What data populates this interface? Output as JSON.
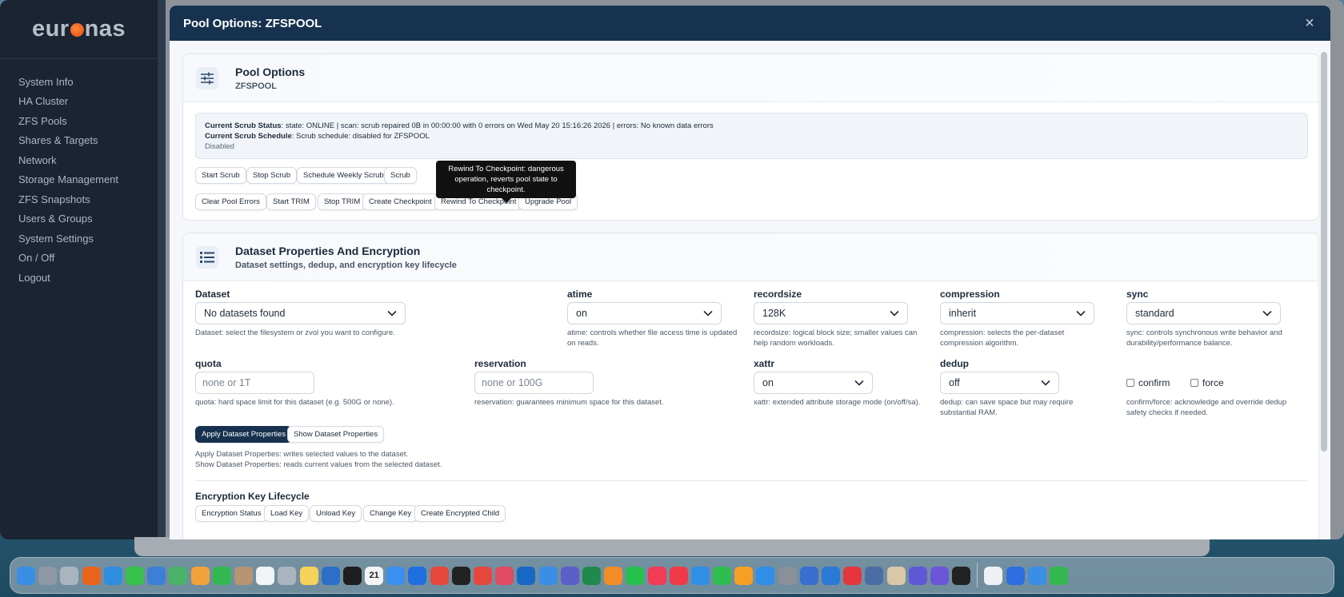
{
  "app": {
    "logo_pre": "eur",
    "logo_post": "nas",
    "nav": [
      {
        "label": "System Info",
        "name": "nav-system-info"
      },
      {
        "label": "HA Cluster",
        "name": "nav-ha-cluster"
      },
      {
        "label": "ZFS Pools",
        "name": "nav-zfs-pools"
      },
      {
        "label": "Shares & Targets",
        "name": "nav-shares-targets"
      },
      {
        "label": "Network",
        "name": "nav-network"
      },
      {
        "label": "Storage Management",
        "name": "nav-storage-management"
      },
      {
        "label": "ZFS Snapshots",
        "name": "nav-zfs-snapshots"
      },
      {
        "label": "Users & Groups",
        "name": "nav-users-groups"
      },
      {
        "label": "System Settings",
        "name": "nav-system-settings"
      },
      {
        "label": "On / Off",
        "name": "nav-on-off"
      },
      {
        "label": "Logout",
        "name": "nav-logout"
      }
    ]
  },
  "modal": {
    "title": "Pool Options: ZFSPOOL",
    "close": "×"
  },
  "pool_options": {
    "title": "Pool Options",
    "subtitle": "ZFSPOOL",
    "status_label": "Current Scrub Status",
    "status_text": ": state: ONLINE | scan: scrub repaired 0B in 00:00:00 with 0 errors on Wed May 20 15:16:26 2026 | errors: No known data errors",
    "schedule_label": "Current Scrub Schedule",
    "schedule_text": ": Scrub schedule: disabled for ZFSPOOL",
    "schedule_state": "Disabled",
    "buttons_row1": [
      "Start Scrub",
      "Stop Scrub",
      "Schedule Weekly Scrub",
      "Scrub"
    ],
    "buttons_row2": [
      "Clear Pool Errors",
      "Start TRIM",
      "Stop TRIM",
      "Create Checkpoint",
      "Rewind To Checkpoint",
      "Upgrade Pool"
    ],
    "tooltip": "Rewind To Checkpoint: dangerous operation, reverts pool state to checkpoint."
  },
  "dataset": {
    "title": "Dataset Properties And Encryption",
    "subtitle": "Dataset settings, dedup, and encryption key lifecycle",
    "fields": {
      "dataset": {
        "label": "Dataset",
        "value": "No datasets found",
        "help": "Dataset: select the filesystem or zvol you want to configure."
      },
      "atime": {
        "label": "atime",
        "value": "on",
        "help": "atime: controls whether file access time is updated on reads."
      },
      "recordsize": {
        "label": "recordsize",
        "value": "128K",
        "help": "recordsize: logical block size; smaller values can help random workloads."
      },
      "compression": {
        "label": "compression",
        "value": "inherit",
        "help": "compression: selects the per-dataset compression algorithm."
      },
      "sync": {
        "label": "sync",
        "value": "standard",
        "help": "sync: controls synchronous write behavior and durability/performance balance."
      },
      "quota": {
        "label": "quota",
        "placeholder": "none or 1T",
        "help": "quota: hard space limit for this dataset (e.g. 500G or none)."
      },
      "reservation": {
        "label": "reservation",
        "placeholder": "none or 100G",
        "help": "reservation: guarantees minimum space for this dataset."
      },
      "xattr": {
        "label": "xattr",
        "value": "on",
        "help": "xattr: extended attribute storage mode (on/off/sa)."
      },
      "dedup": {
        "label": "dedup",
        "value": "off",
        "help": "dedup: can save space but may require substantial RAM."
      },
      "confirm": {
        "label": "confirm"
      },
      "force": {
        "label": "force"
      },
      "confirm_force_help": "confirm/force: acknowledge and override dedup safety checks if needed."
    },
    "apply_button": "Apply Dataset Properties",
    "show_button": "Show Dataset Properties",
    "apply_help": "Apply Dataset Properties: writes selected values to the dataset.",
    "show_help": "Show Dataset Properties: reads current values from the selected dataset.",
    "encryption_title": "Encryption Key Lifecycle",
    "encryption_buttons": [
      "Encryption Status",
      "Load Key",
      "Unload Key",
      "Change Key",
      "Create Encrypted Child"
    ]
  },
  "dock": {
    "calendar_day": "21",
    "icons": [
      {
        "name": "finder-icon",
        "color": "#3a8ee6"
      },
      {
        "name": "launchpad-icon",
        "color": "#8e98a6"
      },
      {
        "name": "help-icon",
        "color": "#aab4bf"
      },
      {
        "name": "firefox-icon",
        "color": "#e8641c"
      },
      {
        "name": "safari-icon",
        "color": "#2f8ee0"
      },
      {
        "name": "messages-icon",
        "color": "#36c24a"
      },
      {
        "name": "vpn-icon",
        "color": "#3d7fd6"
      },
      {
        "name": "maps-icon",
        "color": "#4ab36a"
      },
      {
        "name": "photos-icon",
        "color": "#f2a23a"
      },
      {
        "name": "facetime-icon",
        "color": "#32b84f"
      },
      {
        "name": "contacts-icon",
        "color": "#b89572"
      },
      {
        "name": "reminders-icon",
        "color": "#f1f3f5"
      },
      {
        "name": "help2-icon",
        "color": "#aab4bf"
      },
      {
        "name": "notes-icon",
        "color": "#f6d25a"
      },
      {
        "name": "freeform-icon",
        "color": "#2b6fc9"
      },
      {
        "name": "tv-icon",
        "color": "#1e1e1e"
      },
      {
        "name": "calendar-icon",
        "color": "#f4f4f4"
      },
      {
        "name": "mail-icon",
        "color": "#3b8ff0"
      },
      {
        "name": "tiktok-icon",
        "color": "#1f6fe0"
      },
      {
        "name": "chrome-icon",
        "color": "#e6473c"
      },
      {
        "name": "chatgpt-icon",
        "color": "#222222"
      },
      {
        "name": "chrome2-icon",
        "color": "#e6473c"
      },
      {
        "name": "affinity-icon",
        "color": "#e04a63"
      },
      {
        "name": "outlook-icon",
        "color": "#1769c4"
      },
      {
        "name": "finder2-icon",
        "color": "#3a8ee6"
      },
      {
        "name": "teams-icon",
        "color": "#5b5fc7"
      },
      {
        "name": "excel-icon",
        "color": "#1f8a4c"
      },
      {
        "name": "sublime-icon",
        "color": "#f28c28"
      },
      {
        "name": "whatsapp-icon",
        "color": "#25c04d"
      },
      {
        "name": "music-icon",
        "color": "#f23b55"
      },
      {
        "name": "news-icon",
        "color": "#f03a4a"
      },
      {
        "name": "keynote-icon",
        "color": "#2f8fe6"
      },
      {
        "name": "numbers-icon",
        "color": "#2ebd4f"
      },
      {
        "name": "pages-icon",
        "color": "#f5a024"
      },
      {
        "name": "appstore-icon",
        "color": "#2f8ee8"
      },
      {
        "name": "settings-icon",
        "color": "#8a9099"
      },
      {
        "name": "remote-icon",
        "color": "#3a6fd0"
      },
      {
        "name": "windows-icon",
        "color": "#2a79d6"
      },
      {
        "name": "anydesk-icon",
        "color": "#e5363d"
      },
      {
        "name": "proxy-icon",
        "color": "#4a6ea3"
      },
      {
        "name": "preview-icon",
        "color": "#d9c7a8"
      },
      {
        "name": "text-icon",
        "color": "#5e58d6"
      },
      {
        "name": "notion-icon",
        "color": "#6b56d9"
      },
      {
        "name": "terminal-icon",
        "color": "#222222"
      },
      {
        "name": "textedit-icon",
        "color": "#eef0f3"
      },
      {
        "name": "vpn2-icon",
        "color": "#2d6fe0"
      },
      {
        "name": "weather-icon",
        "color": "#3a8ee6"
      },
      {
        "name": "facetime2-icon",
        "color": "#32b84f"
      }
    ]
  }
}
